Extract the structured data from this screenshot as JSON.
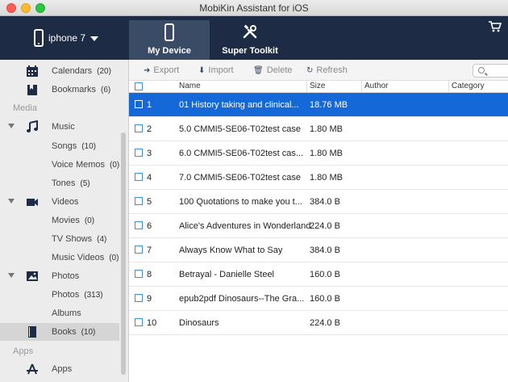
{
  "window": {
    "title": "MobiKin Assistant for iOS"
  },
  "header": {
    "device_name": "iphone 7",
    "tabs": [
      {
        "label": "My Device",
        "icon": "phone-icon",
        "active": true
      },
      {
        "label": "Super Toolkit",
        "icon": "tools-icon",
        "active": false
      }
    ],
    "cart_icon": "cart-icon"
  },
  "sidebar": {
    "items": [
      {
        "label": "Calendars",
        "count": "(20)",
        "icon": "calendar-icon"
      },
      {
        "label": "Bookmarks",
        "count": "(6)",
        "icon": "bookmark-icon"
      },
      {
        "section": "Media"
      },
      {
        "label": "Music",
        "icon": "music-icon",
        "expandable": true
      },
      {
        "label": "Songs",
        "count": "(10)"
      },
      {
        "label": "Voice Memos",
        "count": "(0)"
      },
      {
        "label": "Tones",
        "count": "(5)"
      },
      {
        "label": "Videos",
        "icon": "video-icon",
        "expandable": true
      },
      {
        "label": "Movies",
        "count": "(0)"
      },
      {
        "label": "TV Shows",
        "count": "(4)"
      },
      {
        "label": "Music Videos",
        "count": "(0)"
      },
      {
        "label": "Photos",
        "icon": "photo-icon",
        "expandable": true
      },
      {
        "label": "Photos",
        "count": "(313)"
      },
      {
        "label": "Albums"
      },
      {
        "label": "Books",
        "count": "(10)",
        "icon": "book-icon",
        "selected": true
      },
      {
        "section": "Apps"
      },
      {
        "label": "Apps",
        "icon": "apps-icon"
      }
    ]
  },
  "toolbar": {
    "export": "Export",
    "import": "Import",
    "delete": "Delete",
    "refresh": "Refresh"
  },
  "table": {
    "columns": [
      "Name",
      "Size",
      "Author",
      "Category"
    ],
    "rows": [
      {
        "num": "1",
        "name": "01 History taking and clinical...",
        "size": "18.76 MB",
        "selected": true
      },
      {
        "num": "2",
        "name": "5.0 CMMI5-SE06-T02test case",
        "size": "1.80 MB"
      },
      {
        "num": "3",
        "name": "6.0 CMMI5-SE06-T02test cas...",
        "size": "1.80 MB"
      },
      {
        "num": "4",
        "name": "7.0 CMMI5-SE06-T02test case",
        "size": "1.80 MB"
      },
      {
        "num": "5",
        "name": "100 Quotations to make you t...",
        "size": "384.0 B"
      },
      {
        "num": "6",
        "name": "Alice's Adventures in Wonderland",
        "size": "224.0 B"
      },
      {
        "num": "7",
        "name": "Always Know What to Say",
        "size": "384.0 B"
      },
      {
        "num": "8",
        "name": "Betrayal - Danielle Steel",
        "size": "160.0 B"
      },
      {
        "num": "9",
        "name": "epub2pdf Dinosaurs--The Gra...",
        "size": "160.0 B"
      },
      {
        "num": "10",
        "name": "Dinosaurs",
        "size": "224.0 B"
      }
    ]
  },
  "colors": {
    "header_bg": "#1d2c44",
    "active_tab": "#3a4b66",
    "selection": "#1468d8"
  }
}
